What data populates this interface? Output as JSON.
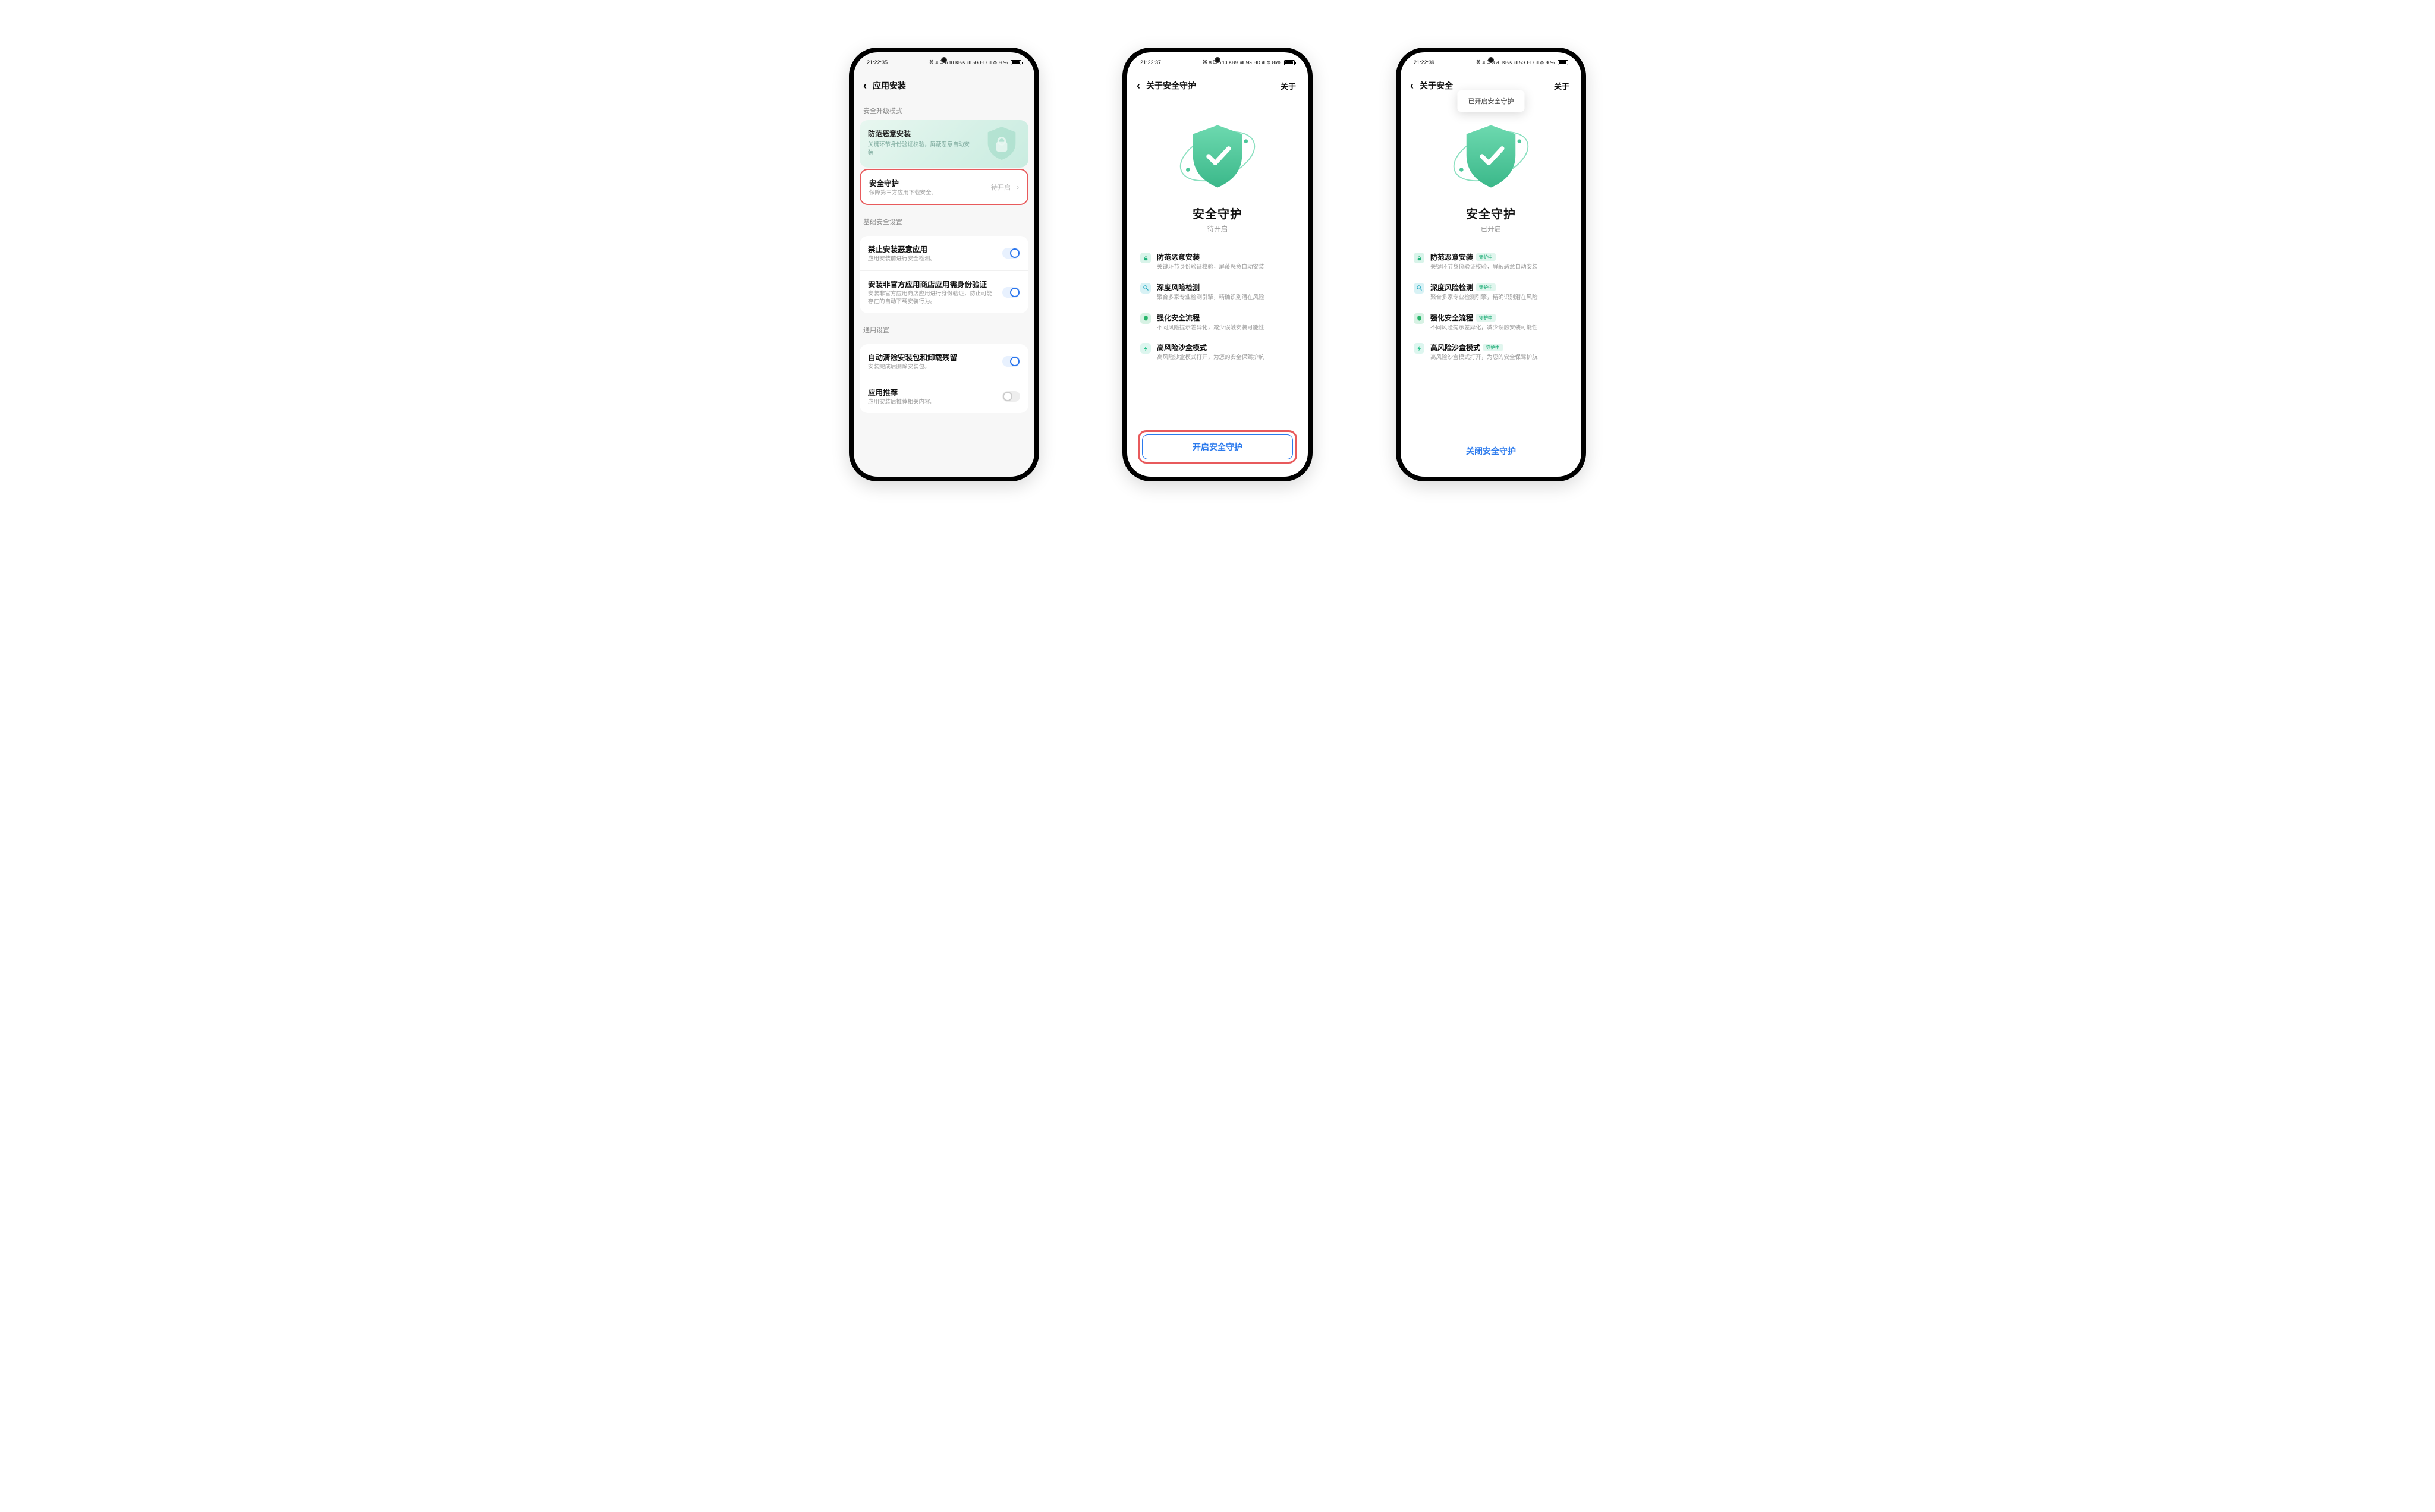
{
  "status": {
    "time1": "21:22:35",
    "time2": "21:22:37",
    "time3": "21:22:39",
    "speed1": "6.10",
    "speed2": "6.10",
    "speed3": "3.20",
    "speed_unit": "KB/s",
    "net": "5G",
    "hd": "HD",
    "battery_pct": "86%",
    "icons": "⌘ ⋇ ⏍"
  },
  "screen1": {
    "title": "应用安装",
    "section_mode": "安全升级模式",
    "card": {
      "title": "防范恶意安装",
      "sub": "关键环节身份验证校验，屏蔽恶意自动安装"
    },
    "guard": {
      "title": "安全守护",
      "sub": "保障第三方应用下载安全。",
      "status": "待开启"
    },
    "section_base": "基础安全设置",
    "block_malicious": {
      "title": "禁止安装恶意应用",
      "sub": "应用安装前进行安全检测。"
    },
    "identity": {
      "title": "安装非官方应用商店应用需身份验证",
      "sub": "安装非官方应用商店应用进行身份验证，防止可能存在的自动下载安装行为。"
    },
    "section_general": "通用设置",
    "autoclean": {
      "title": "自动清除安装包和卸载残留",
      "sub": "安装完成后删除安装包。"
    },
    "recommend": {
      "title": "应用推荐",
      "sub": "应用安装后推荐相关内容。"
    }
  },
  "screen2": {
    "title": "关于安全守护",
    "about": "关于",
    "heading": "安全守护",
    "status": "待开启",
    "btn": "开启安全守护"
  },
  "screen3": {
    "title": "关于安全",
    "about": "关于",
    "toast": "已开启安全守护",
    "heading": "安全守护",
    "status": "已开启",
    "tag": "守护中",
    "btn": "关闭安全守护"
  },
  "features": {
    "f1": {
      "title": "防范恶意安装",
      "sub": "关键环节身份验证校验，屏蔽恶意自动安装"
    },
    "f2": {
      "title": "深度风险检测",
      "sub": "聚合多家专业检测引擎，精确识别潜在风险"
    },
    "f3": {
      "title": "强化安全流程",
      "sub": "不同风险提示差异化，减少误触安装可能性"
    },
    "f4": {
      "title": "高风险沙盒模式",
      "sub": "高风险沙盒模式打开，为您的安全保驾护航"
    }
  }
}
